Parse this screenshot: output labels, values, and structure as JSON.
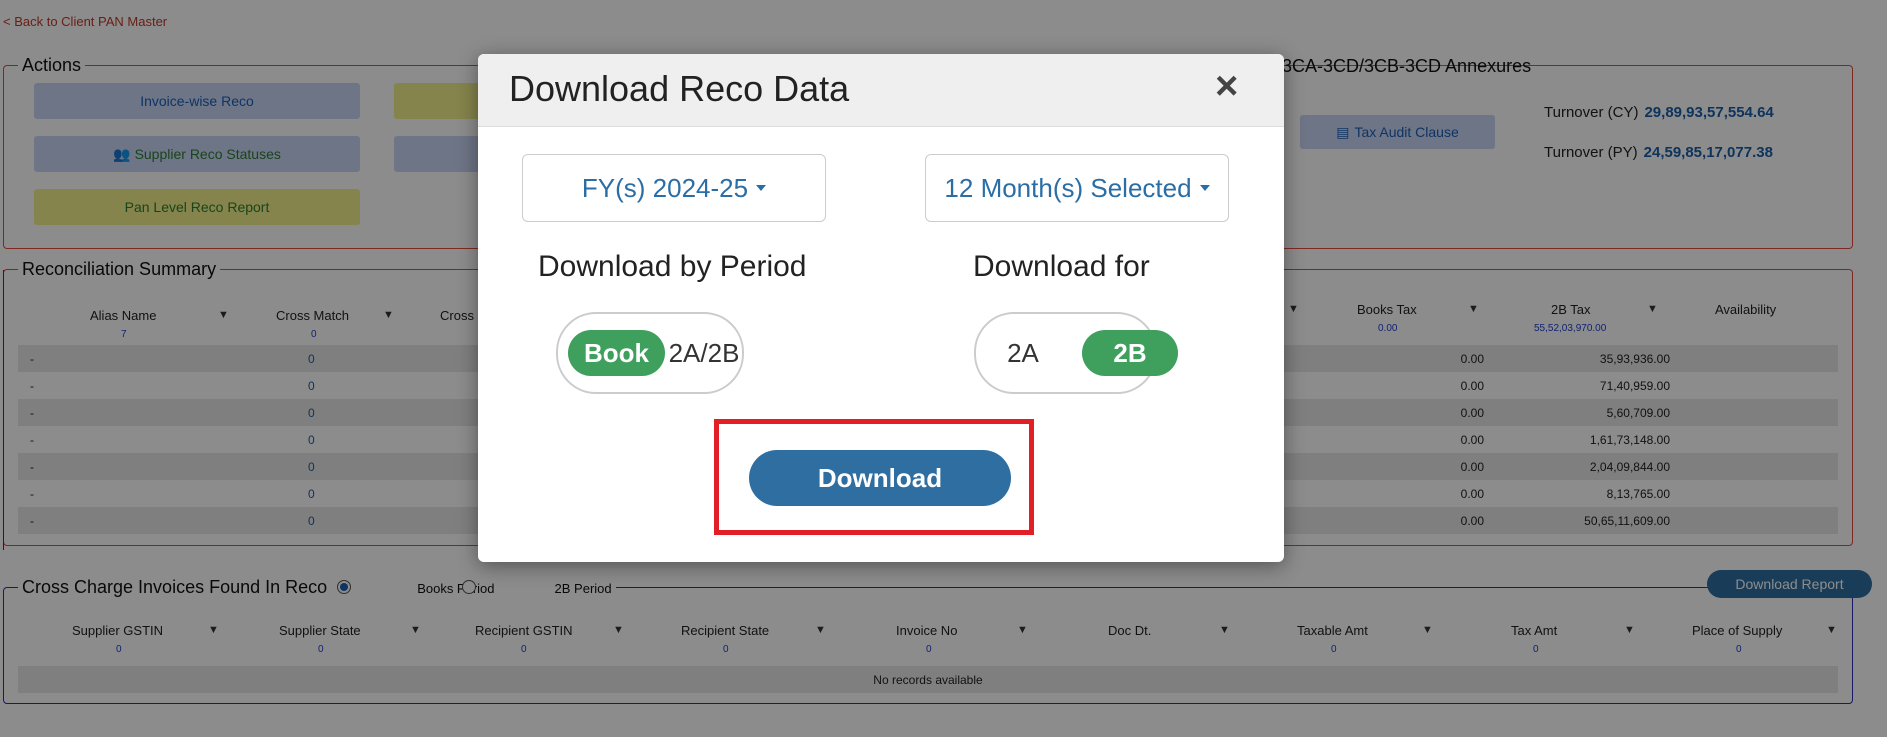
{
  "back_link": "< Back to Client PAN Master",
  "actions": {
    "legend": "Actions",
    "invoice_wise": "Invoice-wise Reco",
    "supplier_reco": "Supplier Reco Statuses",
    "pan_level": "Pan Level Reco Report",
    "annexures_title": "3CA-3CD/3CB-3CD Annexures",
    "tax_audit": "Tax Audit Clause",
    "turnover_cy_label": "Turnover (CY)",
    "turnover_cy_value": "29,89,93,57,554.64",
    "turnover_py_label": "Turnover (PY)",
    "turnover_py_value": "24,59,85,17,077.38"
  },
  "recon": {
    "legend": "Reconciliation Summary",
    "headers": {
      "alias": "Alias Name",
      "alias_count": "7",
      "cross_match": "Cross Match",
      "cross_match_count": "0",
      "cross2": "Cross",
      "books_tax": "Books Tax",
      "books_tax_total": "0.00",
      "tax_2b": "2B Tax",
      "tax_2b_total": "55,52,03,970.00",
      "availability": "Availability"
    },
    "rows": [
      {
        "alias": "-",
        "cross_match": "0",
        "books_tax": "0.00",
        "tax_2b": "35,93,936.00"
      },
      {
        "alias": "-",
        "cross_match": "0",
        "books_tax": "0.00",
        "tax_2b": "71,40,959.00"
      },
      {
        "alias": "-",
        "cross_match": "0",
        "books_tax": "0.00",
        "tax_2b": "5,60,709.00"
      },
      {
        "alias": "-",
        "cross_match": "0",
        "books_tax": "0.00",
        "tax_2b": "1,61,73,148.00"
      },
      {
        "alias": "-",
        "cross_match": "0",
        "books_tax": "0.00",
        "tax_2b": "2,04,09,844.00"
      },
      {
        "alias": "-",
        "cross_match": "0",
        "books_tax": "0.00",
        "tax_2b": "8,13,765.00"
      },
      {
        "alias": "-",
        "cross_match": "0",
        "books_tax": "0.00",
        "tax_2b": "50,65,11,609.00"
      }
    ]
  },
  "cross_charge": {
    "legend": "Cross Charge Invoices Found In Reco",
    "radio_books": "Books Period",
    "radio_2b": "2B Period",
    "download_report": "Download Report",
    "headers": [
      "Supplier GSTIN",
      "Supplier State",
      "Recipient GSTIN",
      "Recipient State",
      "Invoice No",
      "Doc Dt.",
      "Taxable Amt",
      "Tax Amt",
      "Place of Supply"
    ],
    "counts": [
      "0",
      "0",
      "0",
      "0",
      "0",
      "",
      "0",
      "0",
      "0"
    ],
    "empty": "No records available"
  },
  "modal": {
    "title": "Download Reco Data",
    "close": "×",
    "fy_select": "FY(s) 2024-25",
    "month_select": "12 Month(s) Selected",
    "period_title": "Download by Period",
    "period_on": "Book",
    "period_off": "2A/2B",
    "for_title": "Download for",
    "for_off": "2A",
    "for_on": "2B",
    "download": "Download"
  }
}
